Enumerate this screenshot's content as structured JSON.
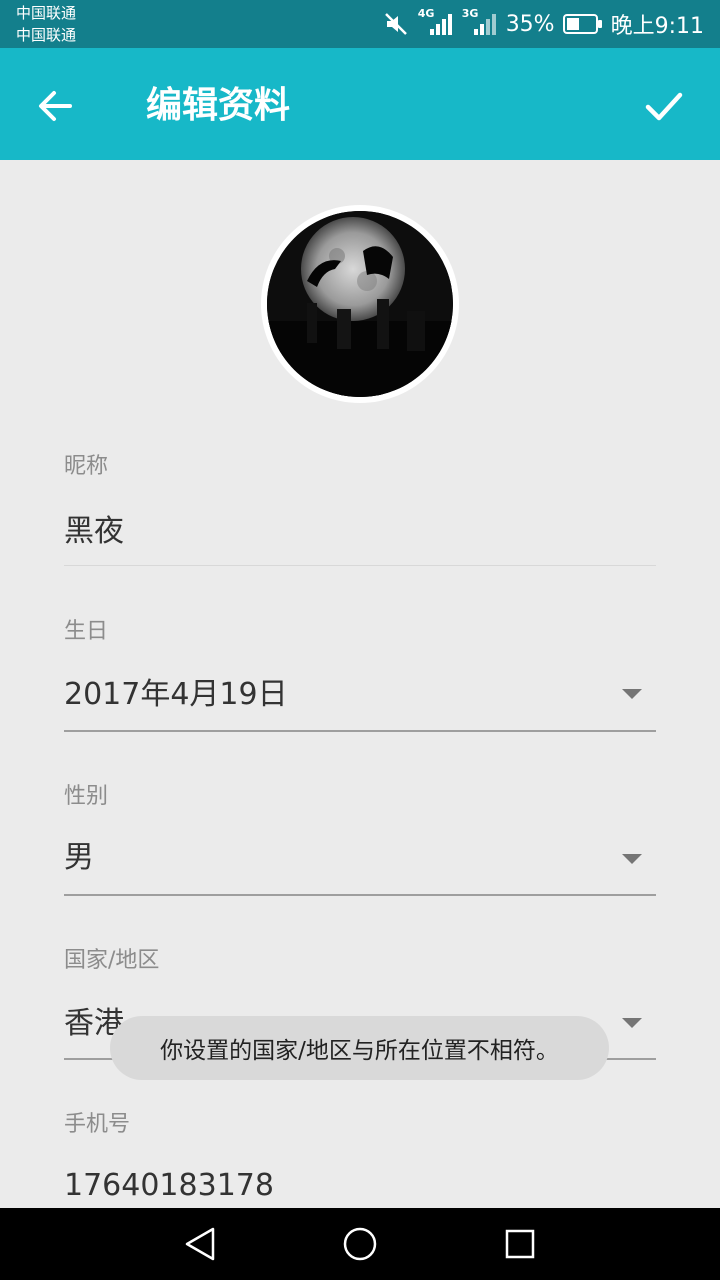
{
  "status_bar": {
    "carrier_1": "中国联通",
    "carrier_2": "中国联通",
    "network_1": "4G",
    "network_2": "3G",
    "battery": "35%",
    "time": "晚上9:11"
  },
  "toolbar": {
    "title": "编辑资料",
    "back_icon": "arrow-left-icon",
    "confirm_icon": "check-icon",
    "background": "#17b8c8"
  },
  "profile": {
    "avatar_description_icon": "avatar-image"
  },
  "form": {
    "nickname": {
      "label": "昵称",
      "value": "黑夜"
    },
    "birthday": {
      "label": "生日",
      "value": "2017年4月19日"
    },
    "gender": {
      "label": "性别",
      "value": "男"
    },
    "region": {
      "label": "国家/地区",
      "value": "香港"
    },
    "phone": {
      "label": "手机号",
      "value": "17640183178"
    }
  },
  "toast": {
    "message": "你设置的国家/地区与所在位置不相符。"
  },
  "nav_bar": {
    "back_icon": "triangle-back-icon",
    "home_icon": "circle-home-icon",
    "recents_icon": "square-recents-icon"
  }
}
